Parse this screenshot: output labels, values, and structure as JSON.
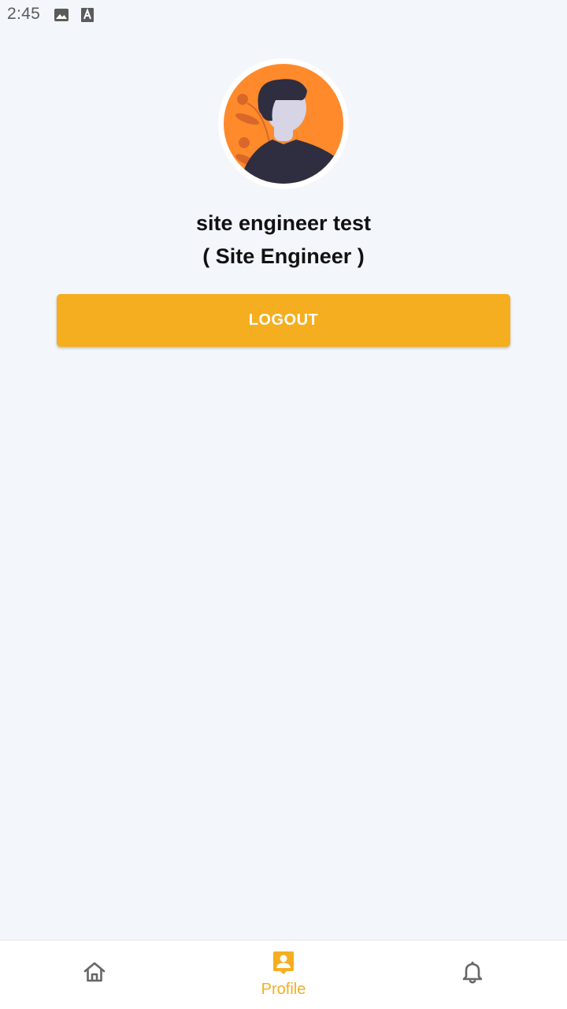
{
  "status_bar": {
    "time": "2:45",
    "icons": [
      "image-icon",
      "accessibility-icon"
    ]
  },
  "profile": {
    "name": "site engineer test",
    "role": "( Site Engineer )",
    "avatar_icon": "person-avatar-illustration"
  },
  "actions": {
    "logout_label": "LOGOUT"
  },
  "bottom_nav": {
    "items": [
      {
        "id": "home",
        "icon": "home-icon",
        "label": "",
        "active": false
      },
      {
        "id": "profile",
        "icon": "profile-icon",
        "label": "Profile",
        "active": true
      },
      {
        "id": "notifications",
        "icon": "bell-icon",
        "label": "",
        "active": false
      }
    ]
  },
  "colors": {
    "accent": "#f5ae1f",
    "background": "#f3f6fa",
    "avatar_bg": "#ff8a2b",
    "inactive_icon": "#666666"
  }
}
